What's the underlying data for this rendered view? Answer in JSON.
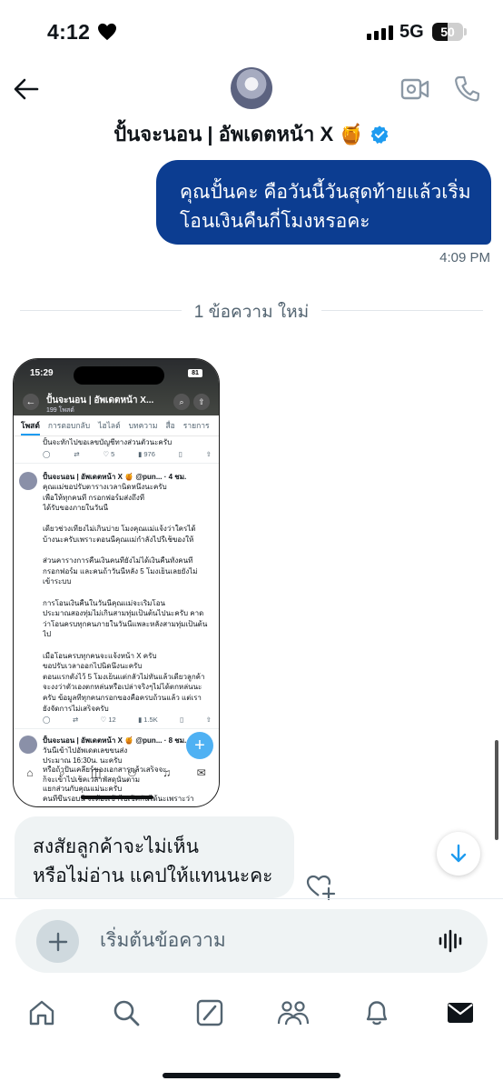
{
  "status_bar": {
    "time": "4:12",
    "network": "5G",
    "battery_level": "50",
    "battery_fraction": 0.5
  },
  "header": {
    "contact_name": "ปั้นจะนอน | อัพเดตหน้า X 🍯",
    "avatar_icon": "avatar-photo",
    "verified_color": "#1d9bf0"
  },
  "messages": {
    "outgoing_text_line1": "คุณปั้นคะ คือวันนี้วันสุดท้ายแล้วเริ่ม",
    "outgoing_text_line2": "โอนเงินคืนกี่โมงหรอคะ",
    "outgoing_time": "4:09 PM",
    "new_divider": "1 ข้อความ ใหม่",
    "incoming_text_line1": "สงสัยลูกค้าจะไม่เห็น",
    "incoming_text_line2": "หรือไม่อ่าน แคปให้แทนนะคะ",
    "outgoing_color": "#0c3d91",
    "incoming_color": "#eff3f4"
  },
  "screenshot": {
    "time": "15:29",
    "battery": "81",
    "profile_name": "ปั้นจะนอน | อัพเดตหน้า X...",
    "post_count": "199 โพสต์",
    "tabs": [
      "โพสต์",
      "การตอบกลับ",
      "ไฮไลต์",
      "บทความ",
      "สื่อ",
      "รายการ"
    ],
    "top_line": "ปั้นจะทักไปขอเลขบัญชีทางส่วนตัวนะครับ",
    "top_actions": [
      "",
      "5",
      "976"
    ],
    "post1_author": "ปั้นจะนอน | อัพเดตหน้า X 🍯 @pun... · 4 ชม.",
    "post1_lines": [
      "คุณแม่ขอปรับตารางเวลานิดหนึ่งนะครับ",
      "เพื่อให้ทุกคนที่ กรอกฟอร์มส่งถึงที่",
      "ได้รับของภายในวันนี้",
      "",
      "เดี๋ยวช่วงเที่ยงไม่เกินบ่าย โมงคุณแม่แจ้งว่าใครได้",
      "บ้างนะครับเพราะตอนนี้คุณแม่กำลังไปรีเช็ของให้",
      "",
      "ส่วนคารางการคืนเงินคนที่ยังไม่ได้เงินคืนทั้งคนที่",
      "กรอกฟอร์ม และคนถ้าวันนี้หลัง 5 โมงเย็นเลยยังไม่",
      "เข้าระบบ",
      "",
      "การโอนเงินคืนในวันนี้คุณแม่จะเริ่มโอน",
      "ประมาณสองทุ่มไม่เกินสามทุ่มเป็นต้นไปนะครับ คาด",
      "ว่าโอนครบทุกคนภายในวันนี้แพละหลังสามทุ่มเป็นต้น",
      "ไป",
      "",
      "เมื่อโอนครบทุกคนจะแจ้งหน้า X ครับ",
      "ขอปรับเวลาออกไปนิดนึงนะครับ",
      "ตอนแรกตั้งไว้ 5 โมงเย็นแต่กลัวไม่ทันแล้วเดี๋ยวลูกค้า",
      "จะงงว่าตัวเองตกหล่นหรือเปล่าจริงๆไม่ได้ตกหล่นนะ",
      "ครับ ข้อมูลที่ทุกคนกรอกของคือครบถ้วนแล้ว แต่เรา",
      "ยังจัดการไม่เสร็จครับ"
    ],
    "post1_actions": [
      "",
      "12",
      "1.5K"
    ],
    "post2_author": "ปั้นจะนอน | อัพเดตหน้า X 🍯 @pun... · 8 ชม.",
    "post2_lines": [
      "วันนี้เข้าไปอัพเดตเลขขนส่ง",
      "ประมาณ 16:30น. นะครับ",
      "หรือถ้าปั้นเคลียร์ของเอกสารแล้วเสร็จจะ",
      "ก็จะเข้าไปเช็คเวลาพัสดุนั้นตาม",
      "แยกส่วนกับคุณแม่นะครับ",
      "คนที่ขึ้นรอบนี้ จะต้องเข้าไปเช็คกันได้นะเพราะว่า"
    ]
  },
  "composer": {
    "placeholder": "เริ่มต้นข้อความ"
  },
  "nav": {
    "items": [
      "home-icon",
      "search-icon",
      "grok-icon",
      "communities-icon",
      "notifications-icon",
      "messages-icon"
    ]
  }
}
